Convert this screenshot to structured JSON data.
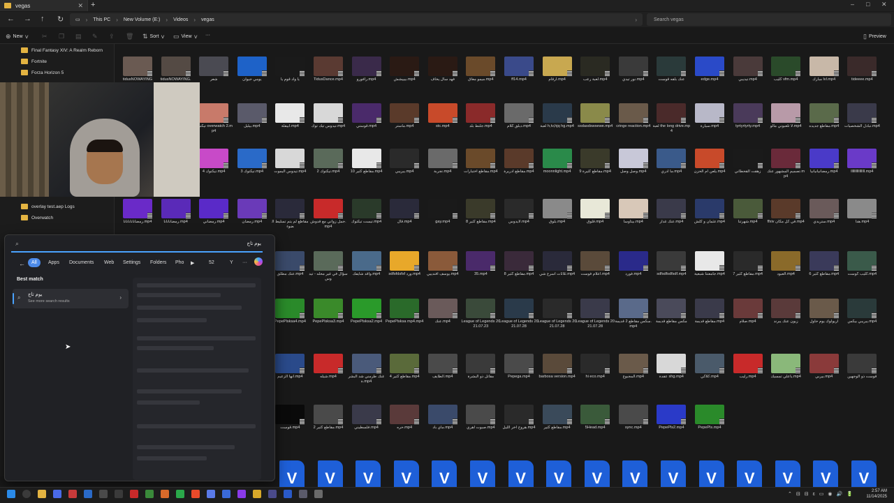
{
  "window": {
    "tab_title": "vegas",
    "new_tab_icon": "plus-icon",
    "controls": [
      "–",
      "□",
      "✕"
    ]
  },
  "address": {
    "breadcrumbs": [
      "This PC",
      "New Volume (E:)",
      "Videos",
      "vegas"
    ],
    "search_placeholder": "Search vegas"
  },
  "commands": {
    "new": "New",
    "sort": "Sort",
    "view": "View",
    "more": "···",
    "preview": "Preview"
  },
  "nav_pane": {
    "items": [
      "Final Fantasy XIV: A Realm Reborn",
      "Fortnite",
      "Forza Horizon 5",
      "overlay test.aep Logs",
      "Overwatch"
    ]
  },
  "files": [
    {
      "name": "tidusNOWAYING",
      "color": "#6a5a52"
    },
    {
      "name": "tidusNOWAYING.",
      "color": "#544a44"
    },
    {
      "name": "شعر",
      "color": "#4a4a52"
    },
    {
      "name": "يومي جيوان",
      "color": "#1e62c8"
    },
    {
      "name": "يا واد قوم يا",
      "color": "#1a1a1a"
    },
    {
      "name": "TidusDance.mp4",
      "color": "#5a3a32"
    },
    {
      "name": "رافورو.mp4",
      "color": "#3a2a4a"
    },
    {
      "name": "بيييشش.mp4",
      "color": "#2a1a14"
    },
    {
      "name": "فهد سال يخاف",
      "color": "#2a1a14"
    },
    {
      "name": "ميمو معاق.mp4",
      "color": "#6a4a2a"
    },
    {
      "name": "ff14.mp4",
      "color": "#3a4a8a"
    },
    {
      "name": "ارقام.mp4",
      "color": "#c8a850"
    },
    {
      "name": "لعبة رعب.mp4",
      "color": "#2a2a22"
    },
    {
      "name": "نور تيدي.mp4",
      "color": "#3a3a3a"
    },
    {
      "name": "عنك بلقه قوست",
      "color": "#2a3a3a"
    },
    {
      "name": "edge.mp4",
      "color": "#2a4ac8"
    },
    {
      "name": "تيديبي.mp4",
      "color": "#4a3a3a"
    },
    {
      "name": "كليب vfm.mp4",
      "color": "#2a4a2a"
    },
    {
      "name": "مبارك lvl.mp4",
      "color": "#c8b8a8"
    },
    {
      "name": "tideeee.mp4",
      "color": "#3a2a2a"
    },
    {
      "name": "تيكتوك overwatch 2.mp4",
      "color": "#c87a6a"
    },
    {
      "name": "بيليل.mp4",
      "color": "#5a5a6a"
    },
    {
      "name": "ابيقلة.mp4",
      "color": "#e8e8e8"
    },
    {
      "name": "تيدوس تيك توك.mp4",
      "color": "#d8d8d8"
    },
    {
      "name": "قوستي.mp4",
      "color": "#4a2a6a"
    },
    {
      "name": "ماستر.mp4",
      "color": "#5a3a2a"
    },
    {
      "name": "stc.mp4",
      "color": "#c84a2a"
    },
    {
      "name": "جلنط بلد.mp4",
      "color": "#8a2a2a"
    },
    {
      "name": "دبلق كلام.mp4",
      "color": "#6a6a6a"
    },
    {
      "name": "لعبة h,tv,hjq hg.mp4",
      "color": "#2a3a4a"
    },
    {
      "name": "ssdasdswsewe.mp4",
      "color": "#8a8a4a"
    },
    {
      "name": "cringe reaction.mp4",
      "color": "#6a5a4a"
    },
    {
      "name": "لعبة the long drive.mp4",
      "color": "#4a2a2a"
    },
    {
      "name": "سيارة.mp4",
      "color": "#b8b8c8"
    },
    {
      "name": "tyrtyrtyrty.mp4",
      "color": "#4a3a5a"
    },
    {
      "name": "لا تلعبوني مالو.mp4",
      "color": "#b89aa8"
    },
    {
      "name": "مقاطع جديده.mp4",
      "color": "#5a6a4a"
    },
    {
      "name": "تبادل الشخصيات.mp4",
      "color": "#3a3a4a"
    },
    {
      "name": "تيكتوك 4.mp4",
      "color": "#c84ac8"
    },
    {
      "name": "تيكتوك 3.mp4",
      "color": "#2a6ac8"
    },
    {
      "name": "تيدوس اليموت.mp4",
      "color": "#d8d8d8"
    },
    {
      "name": "تيكتوك 2.mp4",
      "color": "#5a6a5a"
    },
    {
      "name": "مقاطع كثير 10.mp4",
      "color": "#e8e8e8"
    },
    {
      "name": "يبريبي.mp4",
      "color": "#2a2a2a"
    },
    {
      "name": "تجربة.mp4",
      "color": "#6a6a6a"
    },
    {
      "name": "مقاطع اختبارات.mp4",
      "color": "#6a4a2a"
    },
    {
      "name": "مقاطع ادريرة.mp4",
      "color": "#5a3a2a"
    },
    {
      "name": "moonnlight.mp4",
      "color": "#2a8a4a"
    },
    {
      "name": "مقاطع كثيرة 9.mp4",
      "color": "#3a3a2a"
    },
    {
      "name": "وصل وصل.mp4",
      "color": "#c8c8d8"
    },
    {
      "name": "ما ادري.mp4",
      "color": "#3a5a8a"
    },
    {
      "name": "يلعن ام الحزن.mp4",
      "color": "#c84a2a"
    },
    {
      "name": "زهقت القحطاني",
      "color": "#1a1a1a"
    },
    {
      "name": "تصميم المشهور عنك.mp4",
      "color": "#6a2a3a"
    },
    {
      "name": "رمضانيانيانيا.mp4",
      "color": "#4a3ac8"
    },
    {
      "name": "llllllllllllllll.mp4",
      "color": "#6a3ac8"
    },
    {
      "name": "رمضانانانانانا.mp4",
      "color": "#6a2ac8"
    },
    {
      "name": "رمضانانانا.mp4",
      "color": "#5a2ab8"
    },
    {
      "name": "رمضاني.mp4",
      "color": "#5a2ac8"
    },
    {
      "name": "رمضان.mp4",
      "color": "#6a3ab8"
    },
    {
      "name": "مقاطع لم يتم تسليط الضوء",
      "color": "#2a2a3a"
    },
    {
      "name": "جمل زواني مع قدوش.mp4",
      "color": "#c82a2a"
    },
    {
      "name": "تيست تيكتوك.mp4",
      "color": "#2a3a2a"
    },
    {
      "name": "قال.mp4",
      "color": "#2a2a3a"
    },
    {
      "name": "gay.mp4",
      "color": "#1a1a1a"
    },
    {
      "name": "مقاطع كثير 8.mp4",
      "color": "#3a3a2a"
    },
    {
      "name": "لايدوس.mp4",
      "color": "#2a2a2a"
    },
    {
      "name": "بلوق.mp4",
      "color": "#8a8a8a"
    },
    {
      "name": "قلوق.mp4",
      "color": "#e8e8d8"
    },
    {
      "name": "بيتاوسا.mp4",
      "color": "#d8c8b8"
    },
    {
      "name": "عنك غدار.mp4",
      "color": "#3a3a4a"
    },
    {
      "name": "عثمان و كلش.mp4",
      "color": "#2a3a6a"
    },
    {
      "name": "شهرتنا.mp4",
      "color": "#4a5a3a"
    },
    {
      "name": "ffxiv في كل مكان.mp4",
      "color": "#5a3a2a"
    },
    {
      "name": "ستريدي.mp4",
      "color": "#6a5a5a"
    },
    {
      "name": "هدا.mp4",
      "color": "#8a8a8a"
    },
    {
      "name": "عنك مطلق.mp4",
      "color": "#3a4a6a"
    },
    {
      "name": "سؤال في غير محله - تيدوس",
      "color": "#5a6a5a"
    },
    {
      "name": "واقد شايفك.mp4",
      "color": "#4a6a8a"
    },
    {
      "name": "sdfsfdsfsf ورد.mp4",
      "color": "#e8a82a"
    },
    {
      "name": "يوسف افندييي.mp4",
      "color": "#8a5a3a"
    },
    {
      "name": "35.mp4",
      "color": "#4a2a6a"
    },
    {
      "name": "مقاطع كثير 8.mp4",
      "color": "#3a2a3a"
    },
    {
      "name": "ثلاثات اسرع شي.mp4",
      "color": "#2a2a3a"
    },
    {
      "name": "اعلام فوست.mp4",
      "color": "#5a4a3a"
    },
    {
      "name": "فورد.mp4",
      "color": "#2a2a8a"
    },
    {
      "name": "sdfsdfsdfsdf.mp4",
      "color": "#3a3a3a"
    },
    {
      "name": "جامعتنا شبعية.mp4",
      "color": "#e8e8e8"
    },
    {
      "name": "مقاطع كثير 7.mp4",
      "color": "#2a2a2a"
    },
    {
      "name": "العبود.mp4",
      "color": "#8a6a2a"
    },
    {
      "name": "مقاطع كثير 6.mp4",
      "color": "#3a3a5a"
    },
    {
      "name": "كليب كوست.mp4",
      "color": "#3a5a4a"
    },
    {
      "name": "PepePlsksa4.mp4",
      "color": "#2a8a2a"
    },
    {
      "name": "PepePlsksa3.mp4",
      "color": "#3a8a2a"
    },
    {
      "name": "PepePlsksa2.mp4",
      "color": "#2a9a2a"
    },
    {
      "name": "PepePlsksa mp4.mp4",
      "color": "#2a6a2a"
    },
    {
      "name": "عنك.mp4",
      "color": "#6a5a5a"
    },
    {
      "name": "League of Legends 2021.07.23",
      "color": "#3a4a3a"
    },
    {
      "name": "League of Legends 2021.07.28",
      "color": "#2a3a4a"
    },
    {
      "name": "League of Legends 2021.07.28",
      "color": "#2a2a2a"
    },
    {
      "name": "League of Legends 2021.07.28",
      "color": "#3a3a4a"
    },
    {
      "name": "سكس مقاطع 2 قديمة.mp4",
      "color": "#5a6a8a"
    },
    {
      "name": "مكس مقاطع قديمة",
      "color": "#4a4a5a"
    },
    {
      "name": "مقاطع قديمة.mp4",
      "color": "#3a3a4a"
    },
    {
      "name": "صلام.mp4",
      "color": "#6a3a3a"
    },
    {
      "name": "زيون عنك يبرند",
      "color": "#5a3a3a"
    },
    {
      "name": "اريولوك يوم حاول",
      "color": "#6a5a4a"
    },
    {
      "name": "يبريبي بيكس.mp4",
      "color": "#2a3a3a"
    },
    {
      "name": "انها الزعيم.mp4",
      "color": "#2a4a8a"
    },
    {
      "name": "شيله.mp4",
      "color": "#c82a2a"
    },
    {
      "name": "عنك طرمني شد البشرة.mp4",
      "color": "#4a5a7a"
    },
    {
      "name": "مقاطع كثير 4.mp4",
      "color": "#5a6a3a"
    },
    {
      "name": "الطايف.mp4",
      "color": "#4a4a4a"
    },
    {
      "name": "مقاتل ذو البشرة",
      "color": "#3a3a3a"
    },
    {
      "name": "Pepega.mp4",
      "color": "#4a4a4a"
    },
    {
      "name": "barbosa version.mp4",
      "color": "#5a4a3a"
    },
    {
      "name": "hi eco.mp4",
      "color": "#2a2a2a"
    },
    {
      "name": "المجبوع.mp4",
      "color": "#6a5a4a"
    },
    {
      "name": "عقدة shg.mp4",
      "color": "#d8d8d8"
    },
    {
      "name": "كلاكي.mp4",
      "color": "#4a5a6a"
    },
    {
      "name": "رليب.mp4",
      "color": "#c82a2a"
    },
    {
      "name": "ياعلي تمسيك.mp4",
      "color": "#8ab87a"
    },
    {
      "name": "بيربي.mp4",
      "color": "#8a3a3a"
    },
    {
      "name": "قوست ذو الوجهين",
      "color": "#3a3a3a"
    },
    {
      "name": "قوست.mp4",
      "color": "#0a0a0a"
    },
    {
      "name": "مقاطع كثير 2.mp4",
      "color": "#4a4a4a"
    },
    {
      "name": "فلسطيني.mp4",
      "color": "#3a3a4a"
    },
    {
      "name": "حره.mp4",
      "color": "#5a3a3a"
    },
    {
      "name": "ماي باد.mp4",
      "color": "#3a4a6a"
    },
    {
      "name": "صبوت اهري.mp4",
      "color": "#4a4a4a"
    },
    {
      "name": "هروح اخر الليل.mp4",
      "color": "#2a2a2a"
    },
    {
      "name": "مقاطع كثير.mp4",
      "color": "#3a4a5a"
    },
    {
      "name": "5Head.mp4",
      "color": "#3a5a3a"
    },
    {
      "name": "sync.mp4",
      "color": "#4a4a4a"
    },
    {
      "name": "PepePls2.mp4",
      "color": "#2a3ac8"
    },
    {
      "name": "PepePls.mp4",
      "color": "#2a8a2a"
    }
  ],
  "vegas_docs": [
    "V",
    "V",
    "V",
    "V",
    "V",
    "V",
    "V",
    "V",
    "V",
    "V",
    "V",
    "V",
    "V",
    "V",
    "V",
    "V"
  ],
  "start_search": {
    "query": "يوم تاج",
    "filters": [
      "All",
      "Apps",
      "Documents",
      "Web",
      "Settings",
      "Folders",
      "Pho"
    ],
    "count": "52",
    "best_match_heading": "Best match",
    "best_match_title": "يوم تاج",
    "best_match_sub": "See more search results"
  },
  "clock": {
    "time": "2:57 AM",
    "date": "11/14/2025"
  }
}
